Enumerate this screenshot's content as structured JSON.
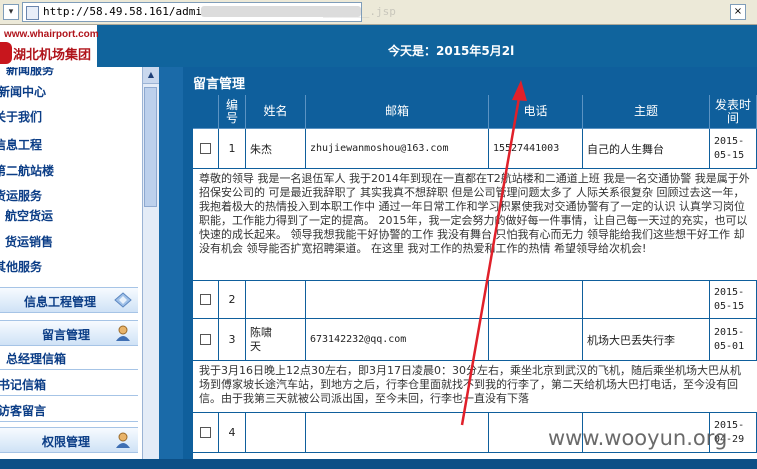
{
  "browser": {
    "url": "http://58.49.58.161/admin/",
    "url_tail": "_______.jsp"
  },
  "header": {
    "logo_url": "www.whairport.com",
    "logo_name": "湖北机场集团",
    "today": "今天是：2015年5月2l"
  },
  "sidebar": {
    "links": [
      "新闻服务",
      "新闻中心",
      "关于我们",
      "信息工程",
      "第二航站楼",
      "货运服务",
      "航空货运",
      "货运销售",
      "其他服务"
    ],
    "sections": [
      {
        "label": "信息工程管理"
      },
      {
        "label": "留言管理"
      },
      {
        "label": "总经理信箱"
      },
      {
        "label": "书记信箱"
      },
      {
        "label": "访客留言"
      },
      {
        "label": "权限管理"
      }
    ]
  },
  "main": {
    "title": "留言管理",
    "columns": [
      "",
      "编号",
      "姓名",
      "邮箱",
      "电话",
      "主题",
      "发表时间"
    ],
    "rows": [
      {
        "id": "1",
        "name": "朱杰",
        "email": "zhujiewanmoshou@163.com",
        "phone": "15527441003",
        "subject": "自己的人生舞台",
        "date": "2015-05-15",
        "message": "尊敬的领导 我是一名退伍军人 我于2014年到现在一直都在T2航站楼和二通道上班 我是一名交通协警 我是属于外招保安公司的 可是最近我辞职了 其实我真不想辞职 但是公司管理问题太多了 人际关系很复杂 回顾过去这一年，我抱着极大的热情投入到本职工作中 通过一年日常工作和学习积累使我对交通协警有了一定的认识 认真学习岗位职能，工作能力得到了一定的提高。 2015年，我一定会努力的做好每一件事情，让自己每一天过的充实，也可以快速的成长起来。 领导我想我能干好协警的工作 我没有舞台 只怕我有心而无力 领导能给我们这些想干好工作 却没有机会 领导能否扩宽招聘渠道。 在这里 我对工作的热爱和工作的热情 希望领导给次机会!"
      },
      {
        "id": "2",
        "name": "",
        "email": "",
        "phone": "",
        "subject": "",
        "date": "2015-05-15",
        "message": ""
      },
      {
        "id": "3",
        "name": "陈啸天",
        "email": "673142232@qq.com",
        "phone": "",
        "subject": "机场大巴丢失行李",
        "date": "2015-05-01",
        "message": "我于3月16日晚上12点30左右，即3月17日凌晨0：30分左右，乘坐北京到武汉的飞机，随后乘坐机场大巴从机场到傅家坡长途汽车站，到地方之后，行李仓里面就找不到我的行李了，第二天给机场大巴打电话，至今没有回信。由于我第三天就被公司派出国，至今未回，行李也一直没有下落"
      },
      {
        "id": "4",
        "name": "",
        "email": "",
        "phone": "",
        "subject": "",
        "date": "2015-04-29",
        "message": ""
      }
    ]
  },
  "watermark": "www.wooyun.org",
  "colors": {
    "header_blue": "#10649d",
    "table_border": "#0f5f9c",
    "annotation_red": "#e0202a",
    "logo_red": "#b0141b"
  }
}
